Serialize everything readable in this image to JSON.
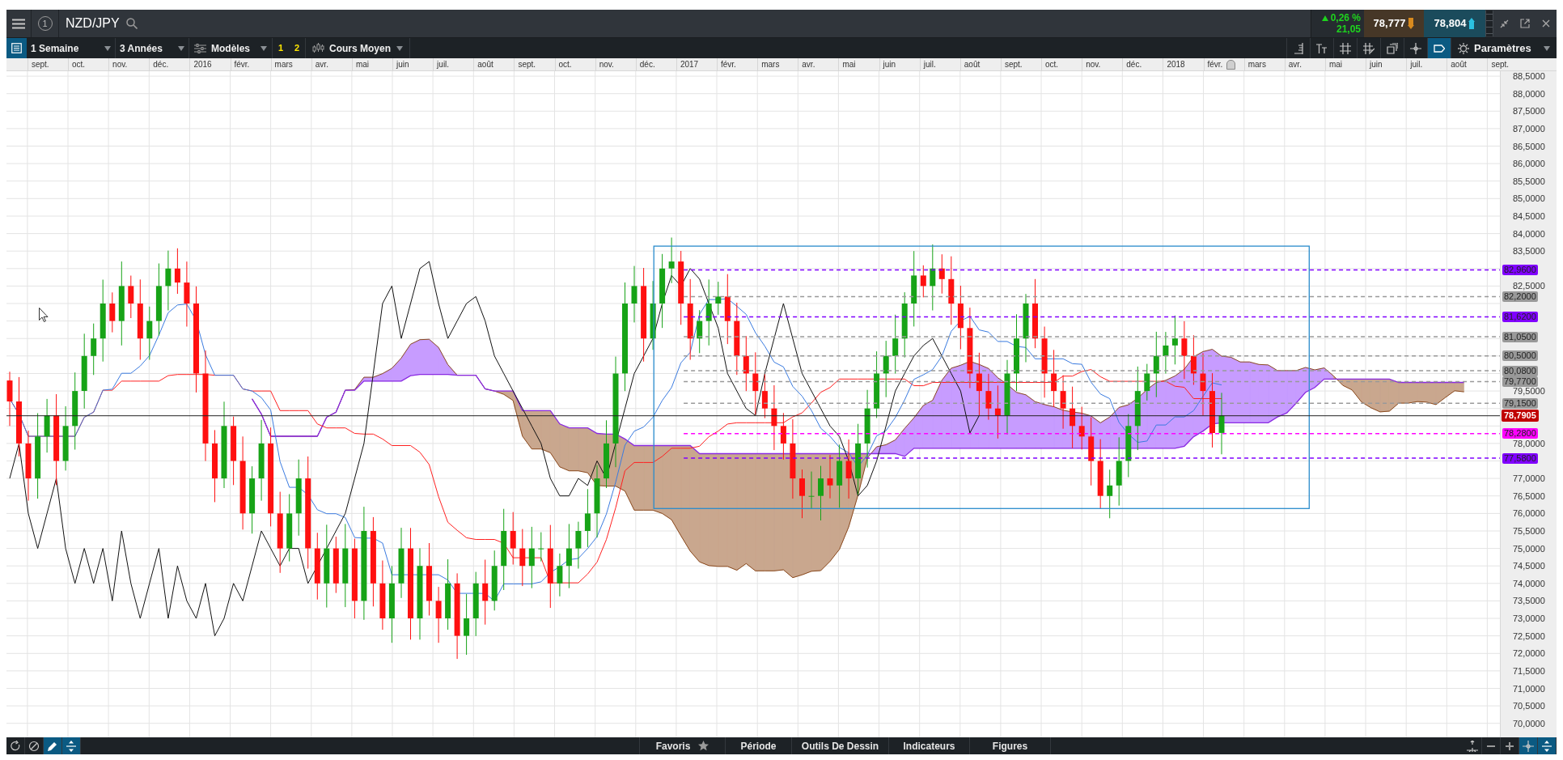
{
  "window": {
    "badge": "1",
    "title": "NZD/JPY"
  },
  "quote": {
    "change": "0,26 %",
    "points": "21,05",
    "bid": "78,777",
    "ask": "78,804"
  },
  "toolbar": {
    "list_button": {
      "selected": true
    },
    "period": "1 Semaine",
    "range": "3 Années",
    "templates": "Modèles",
    "presets": [
      "1",
      "2"
    ],
    "chart_type": "Cours Moyen",
    "tools": [
      {
        "kind": "ruler",
        "selected": false
      },
      {
        "kind": "text",
        "selected": false
      },
      {
        "kind": "grid",
        "selected": false
      },
      {
        "kind": "grid-pen",
        "selected": false
      },
      {
        "kind": "windows",
        "selected": false
      },
      {
        "kind": "crosshair",
        "selected": false
      },
      {
        "kind": "tag",
        "selected": true
      }
    ],
    "settings": "Paramètres"
  },
  "chart": {
    "date_labels": [
      "sept.",
      "oct.",
      "nov.",
      "déc.",
      "2016",
      "févr.",
      "mars",
      "avr.",
      "mai",
      "juin",
      "juil.",
      "août",
      "sept.",
      "oct.",
      "nov.",
      "déc.",
      "2017",
      "févr.",
      "mars",
      "avr.",
      "mai",
      "juin",
      "juil.",
      "août",
      "sept.",
      "oct.",
      "nov.",
      "déc.",
      "2018",
      "févr.",
      "mars",
      "avr.",
      "mai",
      "juin",
      "juil.",
      "août",
      "sept."
    ],
    "price_labels": [
      "88,5000",
      "88,0000",
      "87,5000",
      "87,0000",
      "86,5000",
      "86,0000",
      "85,5000",
      "85,0000",
      "84,5000",
      "84,0000",
      "83,5000",
      "82,5000",
      "79,5000",
      "78,0000",
      "77,0000",
      "76,5000",
      "76,0000",
      "75,5000",
      "75,0000",
      "74,5000",
      "74,0000",
      "73,5000",
      "73,0000",
      "72,5000",
      "72,0000",
      "71,5000",
      "71,0000",
      "70,5000",
      "70,0000"
    ],
    "levels": [
      {
        "kind": "level",
        "label": "82,9600",
        "color": "#8000ff"
      },
      {
        "kind": "level",
        "label": "82,2000",
        "color": "#999999"
      },
      {
        "kind": "level",
        "label": "81,6200",
        "color": "#8000ff"
      },
      {
        "kind": "level",
        "label": "81,0500",
        "color": "#999999"
      },
      {
        "kind": "level",
        "label": "80,5000",
        "color": "#999999"
      },
      {
        "kind": "level",
        "label": "80,0800",
        "color": "#999999"
      },
      {
        "kind": "level",
        "label": "79,7700",
        "color": "#999999"
      },
      {
        "kind": "level",
        "label": "79,1500",
        "color": "#999999"
      },
      {
        "kind": "price",
        "label": "78,7905",
        "color": "#c00000"
      },
      {
        "kind": "level",
        "label": "78,2800",
        "color": "#ff00ff"
      },
      {
        "kind": "level",
        "label": "77,5800",
        "color": "#8000ff"
      }
    ]
  },
  "bottom_bar": {
    "left_tools": [
      {
        "kind": "refresh",
        "selected": false
      },
      {
        "kind": "ban",
        "selected": false
      },
      {
        "kind": "pencil",
        "selected": true
      },
      {
        "kind": "fit",
        "selected": true
      }
    ],
    "menu": [
      {
        "label": "Favoris",
        "kind": "star"
      },
      {
        "label": "Période",
        "kind": "plain"
      },
      {
        "label": "Outils De Dessin",
        "kind": "plain"
      },
      {
        "label": "Indicateurs",
        "kind": "plain"
      },
      {
        "label": "Figures",
        "kind": "plain"
      }
    ],
    "right_tools": [
      {
        "kind": "expand",
        "selected": false
      },
      {
        "kind": "minus",
        "selected": false
      },
      {
        "kind": "plus",
        "selected": false
      },
      {
        "kind": "crosshair",
        "selected": true
      },
      {
        "kind": "fit",
        "selected": true
      }
    ]
  }
}
